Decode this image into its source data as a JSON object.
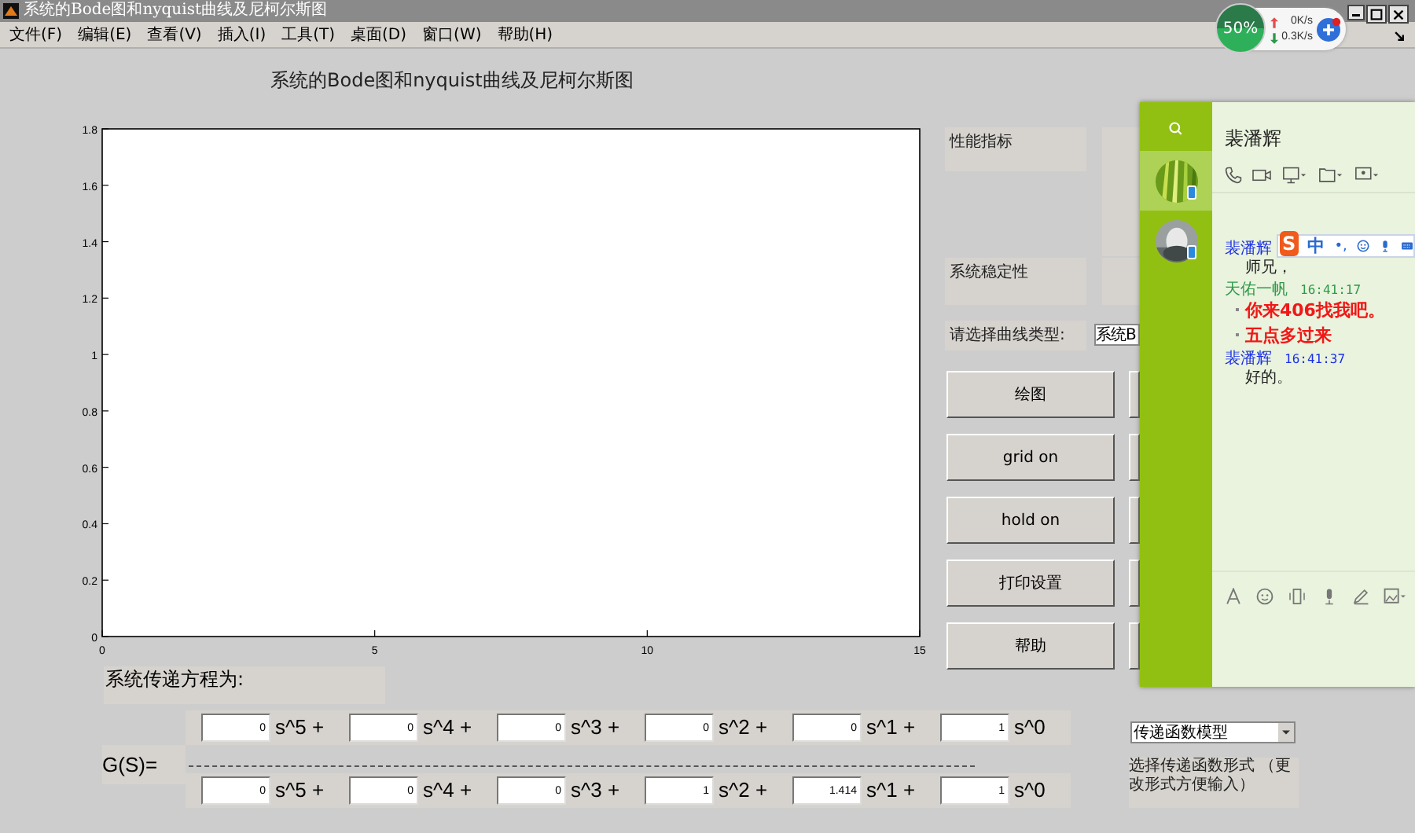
{
  "window": {
    "title": "系统的Bode图和nyquist曲线及尼柯尔斯图"
  },
  "menu": [
    "文件(F)",
    "编辑(E)",
    "查看(V)",
    "插入(I)",
    "工具(T)",
    "桌面(D)",
    "窗口(W)",
    "帮助(H)"
  ],
  "figure_title": "系统的Bode图和nyquist曲线及尼柯尔斯图",
  "axes": {
    "chart_data": {
      "type": "line",
      "xlim": [
        0,
        15
      ],
      "ylim": [
        0,
        1.8
      ],
      "xticks": [
        0,
        5,
        10,
        15
      ],
      "yticks": [
        0,
        0.2,
        0.4,
        0.6,
        0.8,
        1,
        1.2,
        1.4,
        1.6,
        1.8
      ]
    }
  },
  "panel": {
    "performance_label": "性能指标",
    "stability_label": "系统稳定性",
    "curve_type_label": "请选择曲线类型:",
    "curve_type_value": "系统B",
    "buttons": [
      "绘图",
      "grid on",
      "hold on",
      "打印设置",
      "帮助"
    ]
  },
  "transfer": {
    "label": "系统传递方程为:",
    "g_label": "G(S)=",
    "numerator": [
      {
        "value": "0",
        "power": "s^5 +"
      },
      {
        "value": "0",
        "power": "s^4 +"
      },
      {
        "value": "0",
        "power": "s^3 +"
      },
      {
        "value": "0",
        "power": "s^2 +"
      },
      {
        "value": "0",
        "power": "s^1 +"
      },
      {
        "value": "1",
        "power": "s^0"
      }
    ],
    "denominator": [
      {
        "value": "0",
        "power": "s^5 +"
      },
      {
        "value": "0",
        "power": "s^4 +"
      },
      {
        "value": "0",
        "power": "s^3 +"
      },
      {
        "value": "1",
        "power": "s^2 +"
      },
      {
        "value": "1.414",
        "power": "s^1 +"
      },
      {
        "value": "1",
        "power": "s^0"
      }
    ],
    "model_select": "传递函数模型",
    "model_hint": "选择传递函数形式 （更改形式方便输入）"
  },
  "speed_widget": {
    "percent": "50%",
    "upload": "0K/s",
    "download": "0.3K/s"
  },
  "chat": {
    "contact": "裴潘辉",
    "contacts": [
      {
        "selected": true
      },
      {
        "selected": false
      }
    ],
    "messages": [
      {
        "sender": "裴潘辉",
        "color": "#1a2ee8",
        "lines": [
          {
            "text": "师兄，",
            "kind": "plain"
          }
        ]
      },
      {
        "sender": "天佑一帆",
        "color": "#2e9a4a",
        "time": "16:41:17",
        "lines": [
          {
            "text": "你来406找我吧。",
            "kind": "bullet"
          },
          {
            "text": "五点多过来",
            "kind": "bullet"
          }
        ]
      },
      {
        "sender": "裴潘辉",
        "color": "#1a2ee8",
        "time": "16:41:37",
        "lines": [
          {
            "text": "好的。",
            "kind": "plain"
          }
        ]
      }
    ],
    "ime": {
      "logo": "S",
      "mode": "中",
      "punct": "•,"
    }
  }
}
